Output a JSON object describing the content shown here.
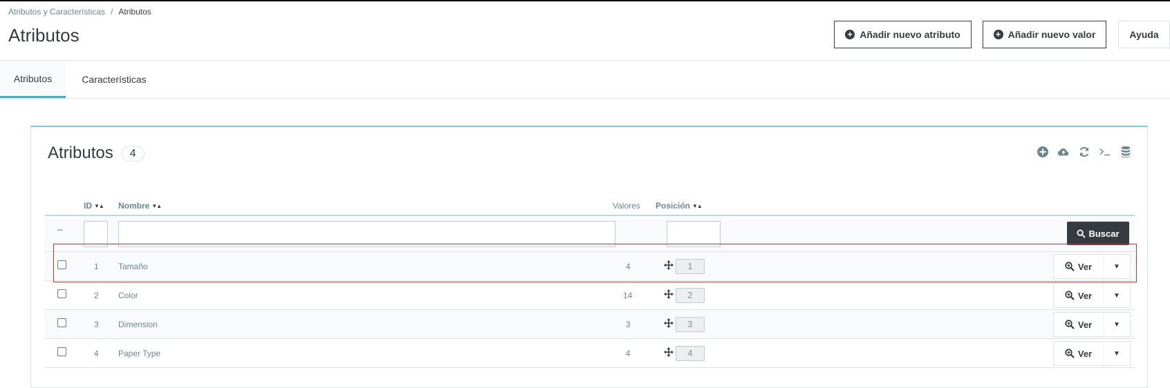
{
  "breadcrumb": {
    "parent": "Atributos y Características",
    "separator": "/",
    "current": "Atributos"
  },
  "page_title": "Atributos",
  "header_buttons": {
    "add_attribute": "Añadir nuevo atributo",
    "add_value": "Añadir nuevo valor",
    "help": "Ayuda"
  },
  "tabs": [
    {
      "label": "Atributos",
      "active": true
    },
    {
      "label": "Características",
      "active": false
    }
  ],
  "card": {
    "title": "Atributos",
    "count": "4",
    "tool_icons": [
      "add-icon",
      "cloud-upload-icon",
      "refresh-icon",
      "terminal-icon",
      "database-icon"
    ]
  },
  "table": {
    "columns": {
      "id": "ID",
      "name": "Nombre",
      "values": "Valores",
      "position": "Posición"
    },
    "filters": {
      "dash_left": "--",
      "dash_values": "--",
      "search_label": "Buscar"
    },
    "rows": [
      {
        "id": "1",
        "name": "Tamaño",
        "values": "4",
        "position": "1"
      },
      {
        "id": "2",
        "name": "Color",
        "values": "14",
        "position": "2"
      },
      {
        "id": "3",
        "name": "Dimension",
        "values": "3",
        "position": "3"
      },
      {
        "id": "4",
        "name": "Paper Type",
        "values": "4",
        "position": "4"
      }
    ],
    "view_label": "Ver"
  },
  "colors": {
    "accent": "#25b9d7",
    "highlight": "#d9302b",
    "dark": "#363a41"
  }
}
